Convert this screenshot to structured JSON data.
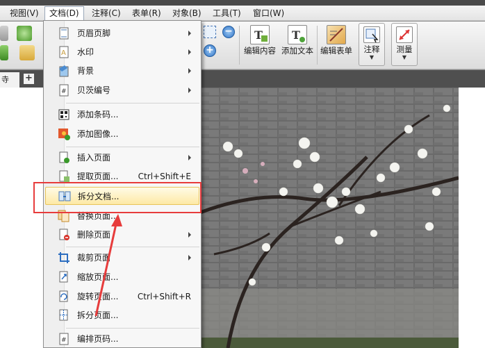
{
  "menubar": {
    "items": [
      {
        "label": "视图(V)"
      },
      {
        "label": "文档(D)"
      },
      {
        "label": "注释(C)"
      },
      {
        "label": "表单(R)"
      },
      {
        "label": "对象(B)"
      },
      {
        "label": "工具(T)"
      },
      {
        "label": "窗口(W)"
      }
    ]
  },
  "toolbar": {
    "edit_content": "编辑内容",
    "add_text": "添加文本",
    "edit_form": "编辑表单",
    "annotate": "注释",
    "measure": "测量"
  },
  "tabs": {
    "doc_tab": "寺",
    "add": "+"
  },
  "document_menu": {
    "items": [
      {
        "label": "页眉页脚",
        "icon": "header-footer-icon",
        "submenu": true
      },
      {
        "label": "水印",
        "icon": "watermark-icon",
        "submenu": true
      },
      {
        "label": "背景",
        "icon": "background-icon",
        "submenu": true
      },
      {
        "label": "贝茨编号",
        "icon": "bates-numbering-icon",
        "submenu": true
      },
      {
        "label": "添加条码...",
        "icon": "barcode-icon"
      },
      {
        "label": "添加图像...",
        "icon": "add-image-icon"
      },
      {
        "label": "插入页面",
        "icon": "insert-page-icon",
        "submenu": true
      },
      {
        "label": "提取页面...",
        "icon": "extract-page-icon",
        "shortcut": "Ctrl+Shift+E"
      },
      {
        "label": "拆分文档...",
        "icon": "split-document-icon",
        "highlighted": true
      },
      {
        "label": "替换页面...",
        "icon": "replace-page-icon"
      },
      {
        "label": "删除页面",
        "icon": "delete-page-icon",
        "submenu": true
      },
      {
        "label": "裁剪页面",
        "icon": "crop-page-icon",
        "submenu": true
      },
      {
        "label": "缩放页面...",
        "icon": "scale-page-icon"
      },
      {
        "label": "旋转页面...",
        "icon": "rotate-page-icon",
        "shortcut": "Ctrl+Shift+R"
      },
      {
        "label": "拆分页面...",
        "icon": "split-page-icon"
      },
      {
        "label": "编排页码...",
        "icon": "page-numbering-icon"
      }
    ]
  },
  "colors": {
    "highlight_border": "#e73c3c",
    "menu_highlight": "#fde9a5"
  }
}
